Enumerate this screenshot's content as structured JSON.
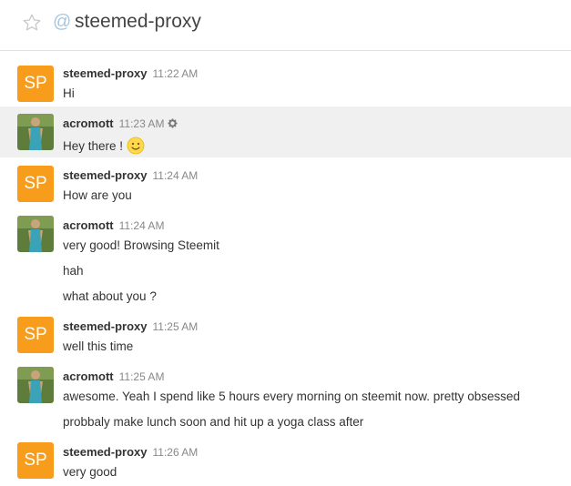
{
  "header": {
    "at_symbol": "@",
    "room_name": "steemed-proxy"
  },
  "avatars": {
    "sp_initials": "SP"
  },
  "messages": [
    {
      "user": "steemed-proxy",
      "time": "11:22 AM",
      "lines": [
        "Hi"
      ]
    },
    {
      "user": "acromott",
      "time": "11:23 AM",
      "lines": [
        "Hey there !"
      ]
    },
    {
      "user": "steemed-proxy",
      "time": "11:24 AM",
      "lines": [
        "How are you"
      ]
    },
    {
      "user": "acromott",
      "time": "11:24 AM",
      "lines": [
        "very good! Browsing Steemit",
        "hah",
        "what about you ?"
      ]
    },
    {
      "user": "steemed-proxy",
      "time": "11:25 AM",
      "lines": [
        "well this time"
      ]
    },
    {
      "user": "acromott",
      "time": "11:25 AM",
      "lines": [
        "awesome. Yeah I spend like 5 hours every morning on steemit now. pretty obsessed",
        "probbaly make lunch soon and hit up a yoga class after"
      ]
    },
    {
      "user": "steemed-proxy",
      "time": "11:26 AM",
      "lines": [
        "very good"
      ]
    }
  ],
  "colors": {
    "sp_avatar": "#f89c1b",
    "highlight_row": "#f0f0f0",
    "at_symbol": "#a7c6dd"
  }
}
